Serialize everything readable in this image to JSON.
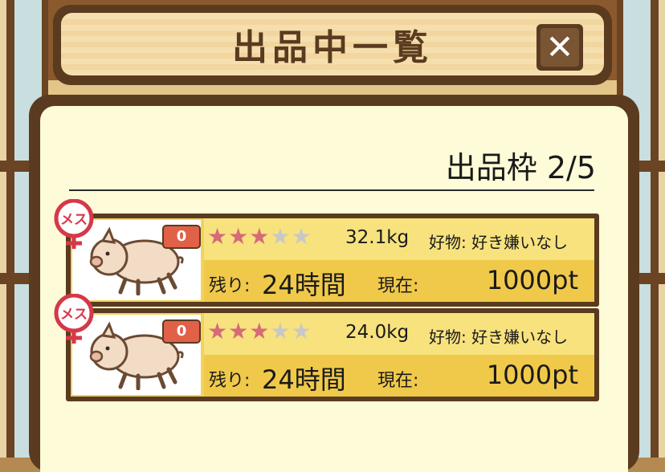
{
  "dialog": {
    "title": "出品中一覧",
    "close_label": "✕",
    "slot_count": "出品枠 2/5"
  },
  "listings": [
    {
      "gender_label": "メス",
      "count": "0",
      "rating": 3,
      "rating_max": 5,
      "weight": "32.1kg",
      "preference": "好物: 好き嫌いなし",
      "remaining_label": "残り:",
      "remaining_value": "24時間",
      "current_label": "現在:",
      "price": "1000pt"
    },
    {
      "gender_label": "メス",
      "count": "0",
      "rating": 3,
      "rating_max": 5,
      "weight": "24.0kg",
      "preference": "好物: 好き嫌いなし",
      "remaining_label": "残り:",
      "remaining_value": "24時間",
      "current_label": "現在:",
      "price": "1000pt"
    }
  ],
  "colors": {
    "frame": "#5a3b1f",
    "star_on": "#d66a77",
    "star_off": "#c8c8c8",
    "badge": "#e06048",
    "gender": "#d6384a"
  },
  "icons": [
    "close-icon",
    "pig-icon",
    "female-icon",
    "star-icon"
  ]
}
